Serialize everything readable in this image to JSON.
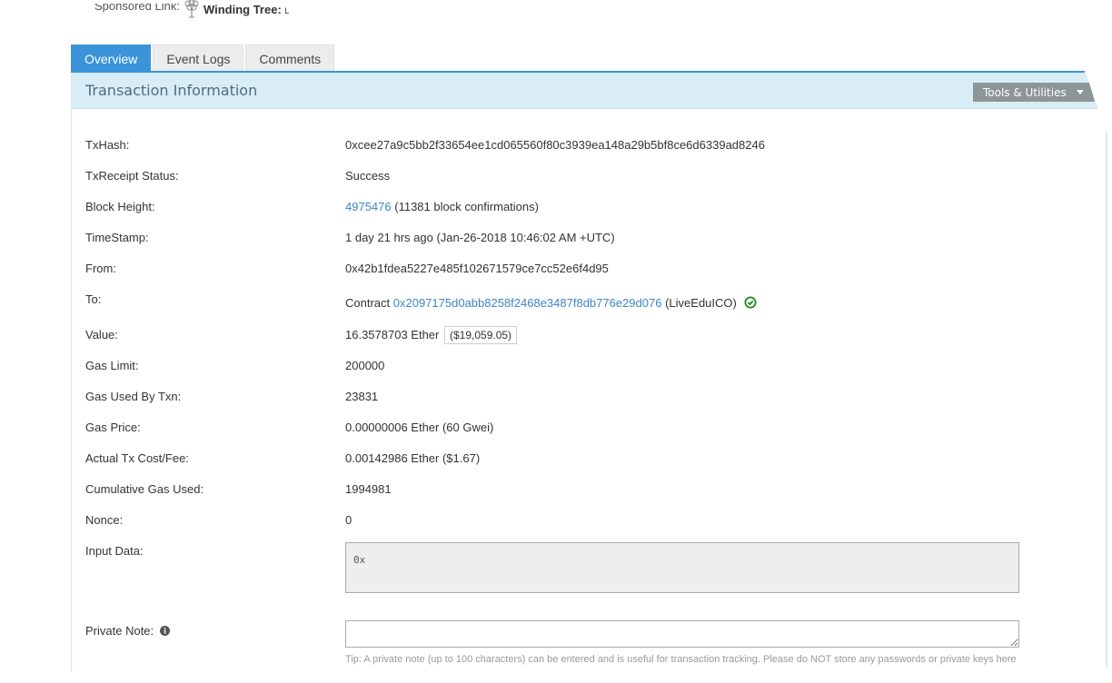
{
  "sponsored": {
    "label": "Sponsored Link:",
    "brand": "Winding Tree:",
    "brand_suffix": "L",
    "icon": "tree-icon"
  },
  "tabs": [
    {
      "label": "Overview",
      "active": true
    },
    {
      "label": "Event Logs",
      "active": false
    },
    {
      "label": "Comments",
      "active": false
    }
  ],
  "panel": {
    "title": "Transaction Information",
    "tools_label": "Tools & Utilities",
    "tools_icon": "caret-down-icon"
  },
  "fields": {
    "txhash": {
      "label": "TxHash:",
      "value": "0xcee27a9c5bb2f33654ee1cd065560f80c3939ea148a29b5bf8ce6d6339ad8246"
    },
    "status": {
      "label": "TxReceipt Status:",
      "value": "Success"
    },
    "block": {
      "label": "Block Height:",
      "block_number": "4975476",
      "confirmations": "(11381 block confirmations)"
    },
    "timestamp": {
      "label": "TimeStamp:",
      "value": "1 day 21 hrs ago (Jan-26-2018 10:46:02 AM +UTC)"
    },
    "from": {
      "label": "From:",
      "value": "0x42b1fdea5227e485f102671579ce7cc52e6f4d95"
    },
    "to": {
      "label": "To:",
      "prefix": "Contract",
      "address": "0x2097175d0abb8258f2468e3487f8db776e29d076",
      "name": "(LiveEduICO)",
      "verified_icon": "check-circle-icon"
    },
    "value": {
      "label": "Value:",
      "ether": "16.3578703 Ether",
      "usd": "($19,059.05)"
    },
    "gas_limit": {
      "label": "Gas Limit:",
      "value": "200000"
    },
    "gas_used": {
      "label": "Gas Used By Txn:",
      "value": "23831"
    },
    "gas_price": {
      "label": "Gas Price:",
      "value": "0.00000006 Ether (60 Gwei)"
    },
    "fee": {
      "label": "Actual Tx Cost/Fee:",
      "value": "0.00142986 Ether ($1.67)"
    },
    "cumulative_gas": {
      "label": "Cumulative Gas Used:",
      "value": "1994981"
    },
    "nonce": {
      "label": "Nonce:",
      "value": "0"
    },
    "input_data": {
      "label": "Input Data:",
      "value": "0x"
    },
    "private_note": {
      "label": "Private Note:",
      "value": "",
      "placeholder": "",
      "info_icon": "info-circle-icon",
      "tip": "Tip: A private note (up to 100 characters) can be entered and is useful for transaction tracking. Please do NOT store any passwords or private keys here"
    }
  },
  "colors": {
    "tab_active": "#3b94d9",
    "link": "#3e85c6",
    "success": "#1a7d1a",
    "header_bg": "#d9edf7",
    "tools_bg": "#8c9696"
  }
}
